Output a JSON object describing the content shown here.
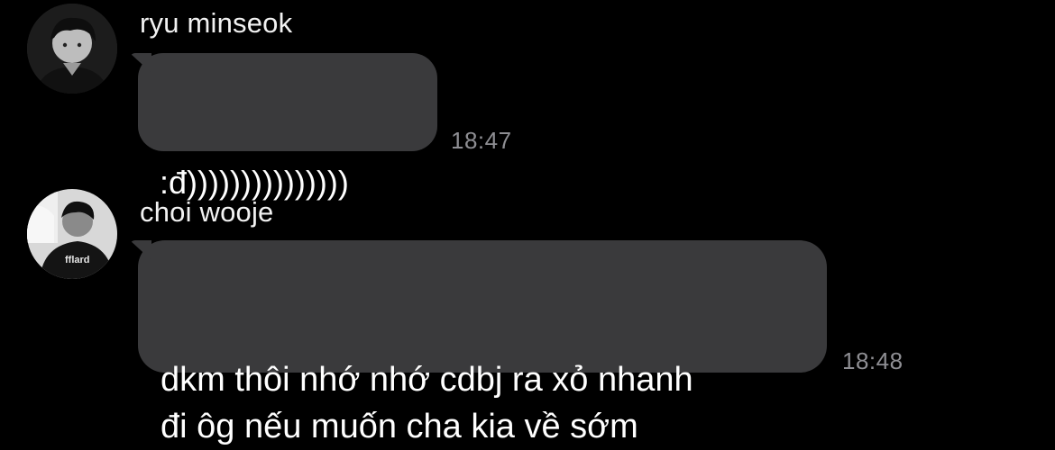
{
  "messages": [
    {
      "sender": "ryu minseok",
      "text": ":đ)))))))))))))))",
      "time": "18:47",
      "avatar": "profile-photo-ryu-minseok"
    },
    {
      "sender": "choi wooje",
      "text": "dkm thôi nhớ nhớ cdbj ra xỏ nhanh\nđi ôg nếu muốn cha kia về sớm",
      "time": "18:48",
      "avatar": "profile-photo-choi-wooje"
    }
  ],
  "colors": {
    "background": "#000000",
    "bubble": "#3a3a3c",
    "text": "#ffffff",
    "timestamp": "#8e8e93"
  }
}
